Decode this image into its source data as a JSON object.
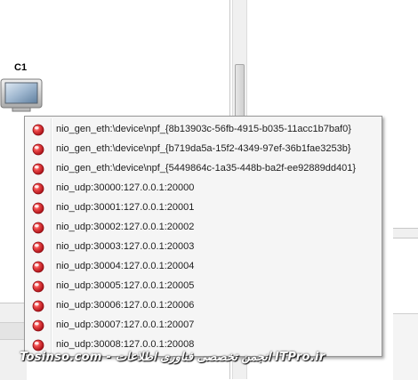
{
  "node": {
    "label": "C1",
    "icon": "monitor-icon"
  },
  "menu": {
    "status_icon": "red-status-led-icon",
    "status_color": "#e0202a",
    "items": [
      {
        "label": "nio_gen_eth:\\device\\npf_{8b13903c-56fb-4915-b035-11acc1b7baf0}"
      },
      {
        "label": "nio_gen_eth:\\device\\npf_{b719da5a-15f2-4349-97ef-36b1fae3253b}"
      },
      {
        "label": "nio_gen_eth:\\device\\npf_{5449864c-1a35-448b-ba2f-ee92889dd401}"
      },
      {
        "label": "nio_udp:30000:127.0.0.1:20000"
      },
      {
        "label": "nio_udp:30001:127.0.0.1:20001"
      },
      {
        "label": "nio_udp:30002:127.0.0.1:20002"
      },
      {
        "label": "nio_udp:30003:127.0.0.1:20003"
      },
      {
        "label": "nio_udp:30004:127.0.0.1:20004"
      },
      {
        "label": "nio_udp:30005:127.0.0.1:20005"
      },
      {
        "label": "nio_udp:30006:127.0.0.1:20006"
      },
      {
        "label": "nio_udp:30007:127.0.0.1:20007"
      },
      {
        "label": "nio_udp:30008:127.0.0.1:20008"
      }
    ]
  },
  "watermark": {
    "text": "Tosinso.com - انجمن تخصصی فناوری اطلاعات ITPro.ir"
  }
}
